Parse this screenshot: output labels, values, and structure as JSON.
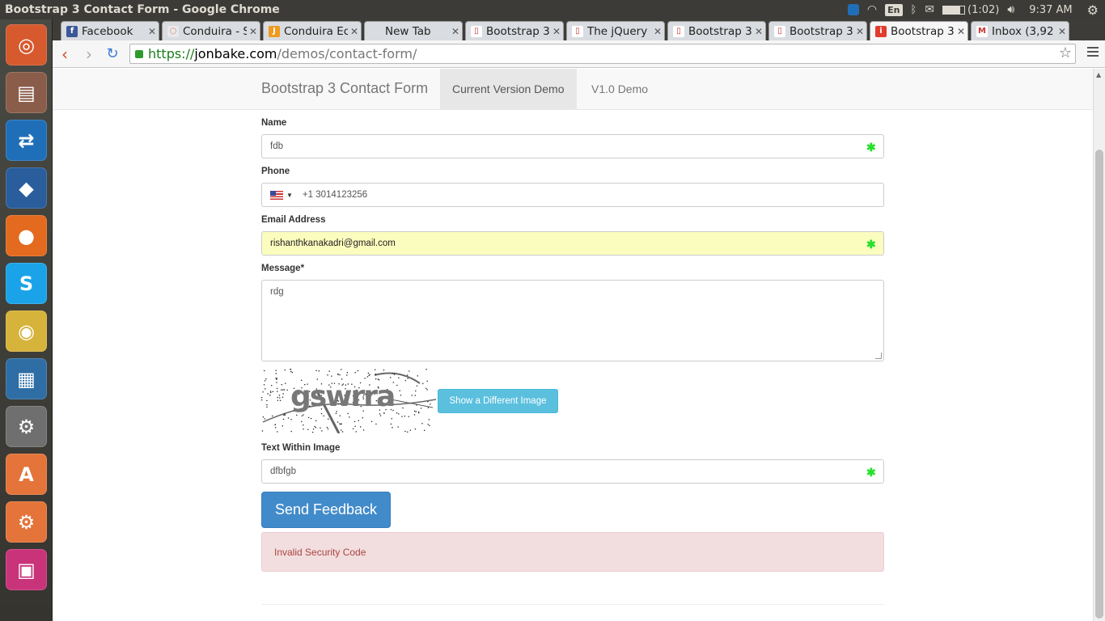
{
  "os": {
    "window_title": "Bootstrap 3 Contact Form - Google Chrome",
    "battery_text": "(1:02)",
    "clock": "9:37 AM",
    "keyboard_lang": "En"
  },
  "launcher": {
    "items": [
      {
        "name": "ubuntu-dash-icon",
        "color": "#d65a2e",
        "glyph": "◎"
      },
      {
        "name": "files-icon",
        "color": "#8a5d4b",
        "glyph": "▤"
      },
      {
        "name": "teamviewer-icon",
        "color": "#1f6fb8",
        "glyph": "⇄"
      },
      {
        "name": "virtualbox-icon",
        "color": "#2a5d9b",
        "glyph": "◆"
      },
      {
        "name": "firefox-icon",
        "color": "#e36a1e",
        "glyph": "●"
      },
      {
        "name": "skype-icon",
        "color": "#1aa3e8",
        "glyph": "S"
      },
      {
        "name": "chrome-icon",
        "color": "#d6b33a",
        "glyph": "◉"
      },
      {
        "name": "libreoffice-writer-icon",
        "color": "#2e6ea4",
        "glyph": "▦"
      },
      {
        "name": "system-settings-icon",
        "color": "#6f6f6f",
        "glyph": "⚙"
      },
      {
        "name": "software-center-icon",
        "color": "#e4743a",
        "glyph": "A"
      },
      {
        "name": "updater-icon",
        "color": "#e4743a",
        "glyph": "⚙"
      },
      {
        "name": "workspace-switcher-icon",
        "color": "#c9337a",
        "glyph": "▣"
      }
    ]
  },
  "tabs": [
    {
      "label": "Facebook",
      "fav_color": "#3b5998",
      "fav_glyph": "f"
    },
    {
      "label": "Conduira - S",
      "fav_color": "#e9e9e9",
      "fav_glyph": "◌"
    },
    {
      "label": "Conduira Ec",
      "fav_color": "#f09a1e",
      "fav_glyph": "J"
    },
    {
      "label": "New Tab",
      "fav_color": "transparent",
      "fav_glyph": ""
    },
    {
      "label": "Bootstrap 3",
      "fav_color": "#ffffff",
      "fav_glyph": "▯"
    },
    {
      "label": "The jQuery",
      "fav_color": "#ffffff",
      "fav_glyph": "▯"
    },
    {
      "label": "Bootstrap 3",
      "fav_color": "#ffffff",
      "fav_glyph": "▯"
    },
    {
      "label": "Bootstrap 3",
      "fav_color": "#ffffff",
      "fav_glyph": "▯"
    },
    {
      "label": "Bootstrap 3",
      "fav_color": "#e33b2e",
      "fav_glyph": "i"
    },
    {
      "label": "Inbox (3,92",
      "fav_color": "#ffffff",
      "fav_glyph": "M"
    }
  ],
  "active_tab_index": 8,
  "address": {
    "scheme": "https://",
    "host": "jonbake.com",
    "path": "/demos/contact-form/"
  },
  "page": {
    "brand": "Bootstrap 3 Contact Form",
    "nav": [
      {
        "label": "Current Version Demo",
        "active": true
      },
      {
        "label": "V1.0 Demo",
        "active": false
      }
    ],
    "form": {
      "name_label": "Name",
      "name_value": "fdb",
      "phone_label": "Phone",
      "phone_value": "+1 3014123256",
      "email_label": "Email Address",
      "email_value": "rishanthkanakadri@gmail.com",
      "message_label": "Message*",
      "message_value": "rdg",
      "captcha_word": "gswrra",
      "captcha_button": "Show a Different Image",
      "captcha_text_label": "Text Within Image",
      "captcha_text_value": "dfbfgb",
      "submit_label": "Send Feedback",
      "error_message": "Invalid Security Code"
    }
  }
}
